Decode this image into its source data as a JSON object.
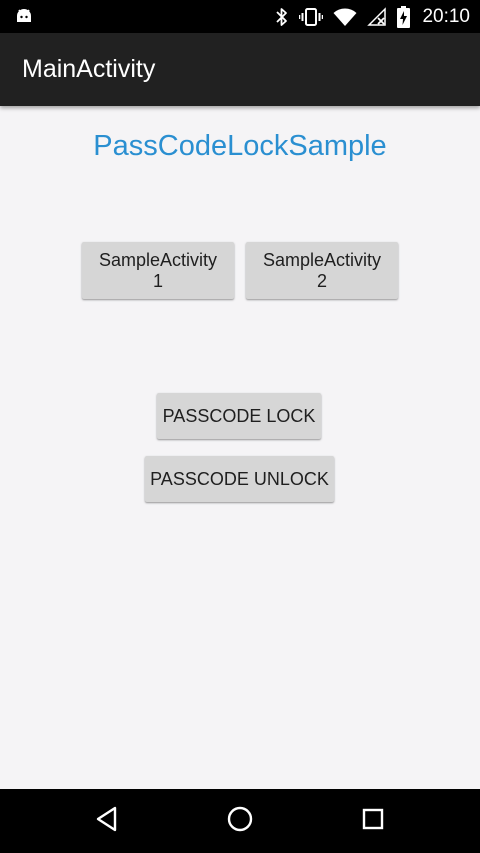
{
  "status_bar": {
    "time": "20:10",
    "icons": [
      "android-icon",
      "bluetooth-icon",
      "vibrate-icon",
      "wifi-icon",
      "no-signal-icon",
      "battery-charging-icon"
    ]
  },
  "app_bar": {
    "title": "MainActivity"
  },
  "main": {
    "heading": "PassCodeLockSample",
    "buttons": {
      "sample1": {
        "line1": "SampleActivity",
        "line2": "1"
      },
      "sample2": {
        "line1": "SampleActivity",
        "line2": "2"
      },
      "lock": "PASSCODE LOCK",
      "unlock": "PASSCODE UNLOCK"
    }
  },
  "nav_bar": {
    "icons": [
      "back-icon",
      "home-icon",
      "recents-icon"
    ]
  },
  "colors": {
    "status_bar": "#000000",
    "app_bar": "#212121",
    "background": "#f5f4f6",
    "accent_text": "#2a8fd1",
    "button": "#d6d6d6"
  }
}
